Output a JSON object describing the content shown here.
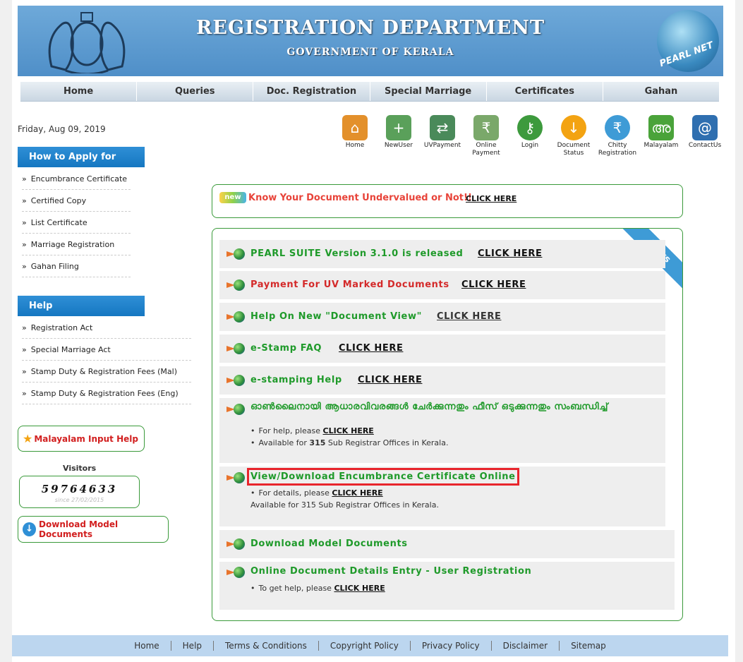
{
  "header": {
    "title": "REGISTRATION DEPARTMENT",
    "subtitle": "GOVERNMENT OF KERALA",
    "logo_text": "PEARL NET"
  },
  "nav": [
    "Home",
    "Queries",
    "Doc. Registration",
    "Special Marriage",
    "Certificates",
    "Gahan"
  ],
  "date": "Friday, Aug 09, 2019",
  "icons": [
    {
      "label": "Home",
      "icon": "house-icon",
      "color": "#e3902b"
    },
    {
      "label": "NewUser",
      "icon": "new-user-icon",
      "color": "#5aa05a"
    },
    {
      "label": "UVPayment",
      "icon": "uv-payment-icon",
      "color": "#4a8a5a"
    },
    {
      "label": "Online Payment",
      "icon": "online-payment-icon",
      "color": "#7aa86a"
    },
    {
      "label": "Login",
      "icon": "key-icon",
      "color": "#3d9a3d"
    },
    {
      "label": "Document Status",
      "icon": "download-icon",
      "color": "#f3a312"
    },
    {
      "label": "Chitty Registration",
      "icon": "rupee-bag-icon",
      "color": "#3e9bd6"
    },
    {
      "label": "Malayalam",
      "icon": "malayalam-icon",
      "color": "#4aa33a"
    },
    {
      "label": "ContactUs",
      "icon": "contact-icon",
      "color": "#2f6fb0"
    }
  ],
  "sidebar": {
    "apply_heading": "How to Apply for",
    "apply_items": [
      "Encumbrance Certificate",
      "Certified Copy",
      "List Certificate",
      "Marriage Registration",
      "Gahan Filing"
    ],
    "help_heading": "Help",
    "help_items": [
      "Registration Act",
      "Special Marriage Act",
      "Stamp Duty & Registration Fees (Mal)",
      "Stamp Duty & Registration Fees (Eng)"
    ],
    "malayalam_help": "Malayalam Input Help",
    "visitors_label": "Visitors",
    "visitor_count": "59764633",
    "visitor_since": "since 27/02/2015",
    "download_docs": "Download Model Documents"
  },
  "notice": {
    "badge": "new",
    "text": "Know Your Document Undervalued or Not!!",
    "click": "CLICK HERE"
  },
  "links": {
    "ribbon": "Links",
    "click": "CLICK HERE",
    "pearl": "PEARL SUITE Version 3.1.0 is released",
    "uv": "Payment For UV Marked Documents",
    "doc_view": "Help On New \"Document View\"",
    "estamp_faq": "e-Stamp FAQ",
    "estamping": "e-stamping Help",
    "mal_title": "ഓൺലൈനായി ആധാരവിവരങ്ങൾ ചേർക്കുന്നതും ഫീസ് ഒടുക്കുന്നതും സംബന്ധിച്ച്",
    "mal_help": "For help, please",
    "mal_avail_pre": "Available for",
    "mal_avail_num": "315",
    "mal_avail_post": "Sub Registrar Offices in Kerala.",
    "ec_title": "View/Download Encumbrance Certificate Online",
    "ec_details": "For details, please",
    "ec_avail": "Available for 315 Sub Registrar Offices in Kerala.",
    "download": "Download Model Documents",
    "online_entry": "Online Document Details Entry - User Registration",
    "online_help": "To get help, please"
  },
  "footer": [
    "Home",
    "Help",
    "Terms & Conditions",
    "Copyright Policy",
    "Privacy Policy",
    "Disclaimer",
    "Sitemap"
  ]
}
